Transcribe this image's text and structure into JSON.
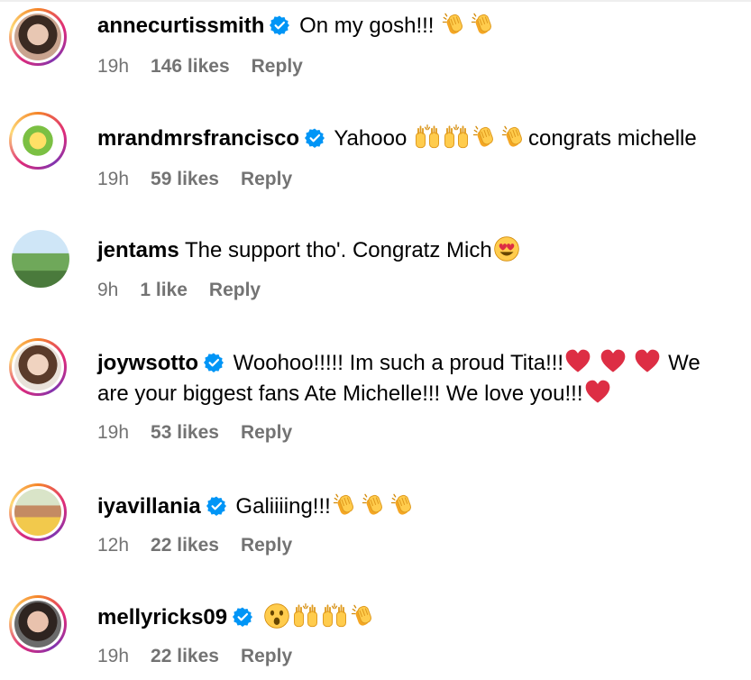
{
  "comments": [
    {
      "username": "annecurtissmith",
      "verified": true,
      "text_before": "On my gosh!!! ",
      "emojis_after": [
        "clap",
        "clap"
      ],
      "time": "19h",
      "likes": "146 likes",
      "reply": "Reply"
    },
    {
      "username": "mrandmrsfrancisco",
      "verified": true,
      "text_before": "Yahooo ",
      "emojis_mid": [
        "raised-hands",
        "raised-hands",
        "clap",
        "clap"
      ],
      "text_after": "congrats michelle",
      "time": "19h",
      "likes": "59 likes",
      "reply": "Reply"
    },
    {
      "username": "jentams",
      "verified": false,
      "text_before": "The support tho'. Congratz Mich",
      "emojis_after": [
        "heart-eyes"
      ],
      "time": "9h",
      "likes": "1 like",
      "reply": "Reply"
    },
    {
      "username": "joywsotto",
      "verified": true,
      "text_line1": "Woohoo!!!!! Im such a proud Tita!!!",
      "text_line1_tail": " We",
      "text_line2": "are your biggest fans Ate Michelle!!! We love you!!!",
      "time": "19h",
      "likes": "53 likes",
      "reply": "Reply"
    },
    {
      "username": "iyavillania",
      "verified": true,
      "text_before": "Galiiiing!!!",
      "emojis_after": [
        "clap",
        "clap",
        "clap"
      ],
      "time": "12h",
      "likes": "22 likes",
      "reply": "Reply"
    },
    {
      "username": "mellyricks09",
      "verified": true,
      "emojis_after": [
        "astonished",
        "raised-hands",
        "raised-hands",
        "clap"
      ],
      "time": "19h",
      "likes": "22 likes",
      "reply": "Reply"
    }
  ],
  "colors": {
    "verified_blue": "#0095f6",
    "meta_gray": "#737373",
    "emoji_yellow": "#ffcc4d",
    "heart_red": "#dd2e44"
  }
}
